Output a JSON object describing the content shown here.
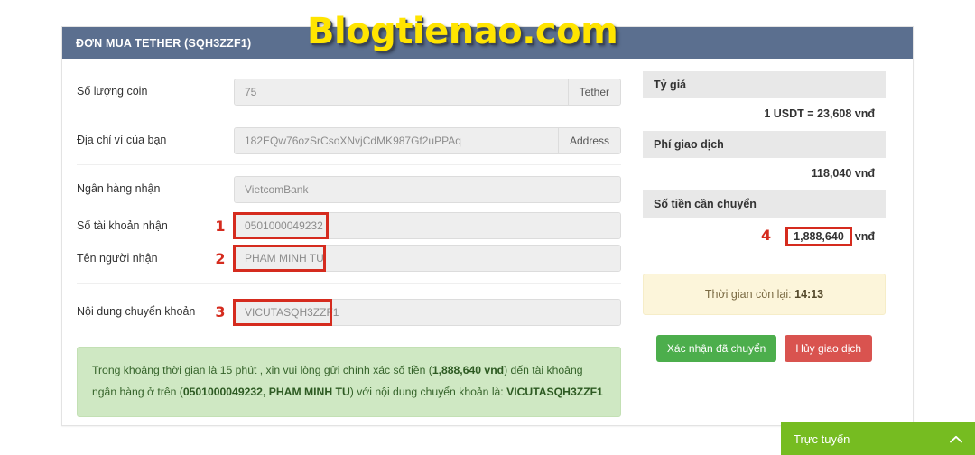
{
  "watermark": {
    "text": "Blogtienao.com"
  },
  "panel": {
    "header_title": "ĐƠN MUA TETHER (SQH3ZZF1)"
  },
  "form": {
    "rows": [
      {
        "label": "Số lượng coin",
        "value": "75",
        "addon": "Tether",
        "marker": ""
      },
      {
        "label": "Địa chỉ ví của bạn",
        "value": "182EQw76ozSrCsoXNvjCdMK987Gf2uPPAq",
        "addon": "Address",
        "marker": ""
      },
      {
        "label": "Ngân hàng nhận",
        "value": "VietcomBank",
        "addon": "",
        "marker": ""
      },
      {
        "label": "Số tài khoản nhận",
        "value": "0501000049232",
        "addon": "",
        "marker": "1"
      },
      {
        "label": "Tên người nhận",
        "value": "PHAM MINH TU",
        "addon": "",
        "marker": "2"
      },
      {
        "label": "Nội dung chuyển khoản",
        "value": "VICUTASQH3ZZF1",
        "addon": "",
        "marker": "3"
      }
    ]
  },
  "alert": {
    "part1": "Trong khoảng thời gian là 15 phút , xin vui lòng gửi chính xác số tiền (",
    "amount": "1,888,640 vnđ",
    "part2": ") đến tài khoảng ngân hàng ở trên (",
    "account": "0501000049232, PHAM MINH TU",
    "part3": ") với nội dung chuyển khoản là: ",
    "content": "VICUTASQH3ZZF1"
  },
  "sidebar": {
    "rate_title": "Tỷ giá",
    "rate_value": "1 USDT = 23,608 vnđ",
    "fee_title": "Phí giao dịch",
    "fee_value": "118,040 vnđ",
    "total_title": "Số tiền cần chuyển",
    "total_marker": "4",
    "total_amount": "1,888,640",
    "total_currency": "vnđ",
    "timer_label": "Thời gian còn lại:",
    "timer_value": "14:13",
    "confirm_label": "Xác nhận đã chuyển",
    "cancel_label": "Hủy giao dịch"
  },
  "chat": {
    "label": "Trực tuyến",
    "chevron": "⌃"
  },
  "colors": {
    "header_blue": "#5b6f8f",
    "annotation_red": "#d52b1e",
    "confirm_green": "#4cae4c",
    "cancel_red": "#d9534f",
    "chat_green": "#76bc21",
    "alert_green_bg": "#cfe8c3",
    "timer_yellow_bg": "#fcf5da",
    "watermark_yellow": "#ffe400"
  }
}
